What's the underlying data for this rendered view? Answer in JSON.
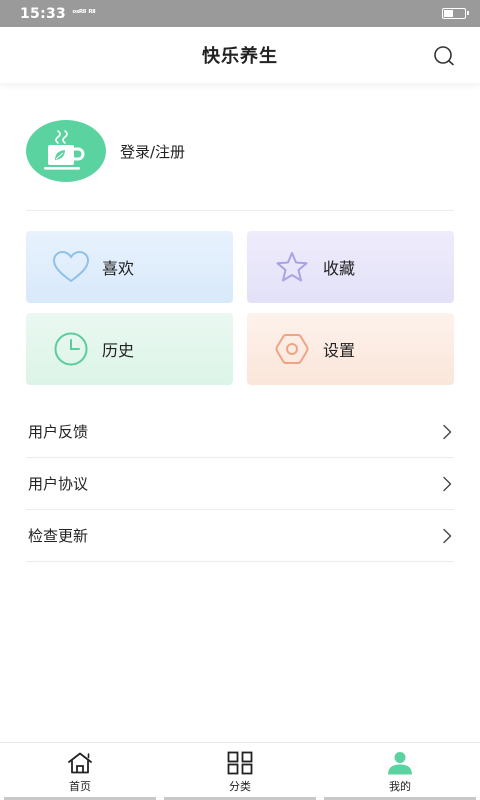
{
  "status_bar": {
    "time": "15:33",
    "signal": "ᵒˢᴿˡˡ ᴿˡˡ",
    "battery_level": 0.45
  },
  "header": {
    "title": "快乐养生"
  },
  "profile": {
    "login_label": "登录/注册"
  },
  "cards": [
    {
      "label": "喜欢"
    },
    {
      "label": "收藏"
    },
    {
      "label": "历史"
    },
    {
      "label": "设置"
    }
  ],
  "menu": [
    {
      "label": "用户反馈"
    },
    {
      "label": "用户协议"
    },
    {
      "label": "检查更新"
    }
  ],
  "tabs": [
    {
      "label": "首页"
    },
    {
      "label": "分类"
    },
    {
      "label": "我的"
    }
  ],
  "colors": {
    "accent": "#5bd3a1",
    "like_icon": "#8fc1ea",
    "fav_icon": "#a9a3e6",
    "history_icon": "#5bcc9c",
    "settings_icon": "#f0a484"
  }
}
